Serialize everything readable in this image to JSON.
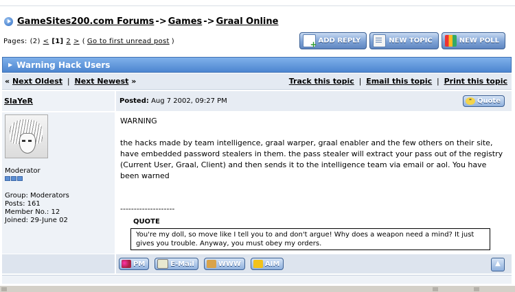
{
  "breadcrumb": {
    "items": [
      "GameSites200.com Forums",
      "Games",
      "Graal Online"
    ],
    "separator": "->"
  },
  "pagination": {
    "label": "Pages:",
    "count": "(2)",
    "prev": "<",
    "current": "[1]",
    "next_page": "2",
    "next": ">",
    "open_paren": "(",
    "first_unread": "Go to first unread post",
    "close_paren": ")"
  },
  "toolbar": {
    "add_reply": "ADD REPLY",
    "new_topic": "NEW TOPIC",
    "new_poll": "NEW POLL"
  },
  "topic": {
    "title": "Warning Hack Users"
  },
  "topic_nav": {
    "prev_arrow": "«",
    "next_oldest": "Next Oldest",
    "divider": "|",
    "next_newest": "Next Newest",
    "next_arrow": "»",
    "track": "Track this topic",
    "email": "Email this topic",
    "print": "Print this topic"
  },
  "post": {
    "author": "SlaYeR",
    "posted_label": "Posted:",
    "date": "Aug 7 2002, 09:27 PM",
    "quote_button": "Quote",
    "role": "Moderator",
    "group": "Group: Moderators",
    "posts": "Posts: 161",
    "member_no": "Member No.: 12",
    "joined": "Joined: 29-June 02",
    "message": {
      "line1": "WARNING",
      "line2": "the hacks made by team intelligence, graal warper, graal enabler and the few others on their site, have embedded password stealers in them. the pass stealer will extract your pass out of the registry (Current User, Graal, Client) and then sends it to the intelligence team via email or aol. You have been warned",
      "separator": "--------------------",
      "quote_label": "QUOTE",
      "quote_text": "You're my doll, so move like I tell you to and don't argue! Why does a weapon need a mind? It just gives you trouble. Anyway, you must obey my orders."
    },
    "footer": {
      "pm": "PM",
      "email": "E-Mail",
      "www": "WWW",
      "aim": "AIM",
      "top": "▲"
    }
  }
}
